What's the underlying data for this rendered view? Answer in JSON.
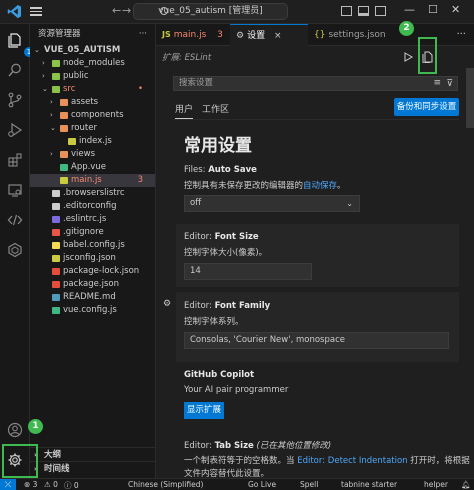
{
  "window": {
    "search_text": "vue_05_autism [管理员]",
    "nav_back": "←",
    "nav_forward": "→"
  },
  "activity": {
    "explorer_badge": "1"
  },
  "sidebar": {
    "header": "资源管理器",
    "more": "···",
    "items": [
      {
        "label": "VUE_05_AUTISM",
        "depth": 0,
        "chev": "⌄",
        "icon": "none",
        "bold": true
      },
      {
        "label": "node_modules",
        "depth": 1,
        "chev": "›",
        "icon": "folder-green"
      },
      {
        "label": "public",
        "depth": 1,
        "chev": "›",
        "icon": "folder-green"
      },
      {
        "label": "src",
        "depth": 1,
        "chev": "⌄",
        "icon": "folder-green",
        "modified": true
      },
      {
        "label": "assets",
        "depth": 2,
        "chev": "›",
        "icon": "folder-orange"
      },
      {
        "label": "components",
        "depth": 2,
        "chev": "›",
        "icon": "folder-orange"
      },
      {
        "label": "router",
        "depth": 2,
        "chev": "⌄",
        "icon": "folder-orange"
      },
      {
        "label": "index.js",
        "depth": 3,
        "chev": "",
        "icon": "js"
      },
      {
        "label": "views",
        "depth": 2,
        "chev": "›",
        "icon": "folder-orange"
      },
      {
        "label": "App.vue",
        "depth": 2,
        "chev": "",
        "icon": "vue"
      },
      {
        "label": "main.js",
        "depth": 2,
        "chev": "",
        "icon": "js",
        "modified": true,
        "badge": "3",
        "selected": true
      },
      {
        "label": ".browserslistrc",
        "depth": 1,
        "chev": "",
        "icon": "gear-dot"
      },
      {
        "label": ".editorconfig",
        "depth": 1,
        "chev": "",
        "icon": "gear-dot"
      },
      {
        "label": ".eslintrc.js",
        "depth": 1,
        "chev": "",
        "icon": "eslint"
      },
      {
        "label": ".gitignore",
        "depth": 1,
        "chev": "",
        "icon": "git"
      },
      {
        "label": "babel.config.js",
        "depth": 1,
        "chev": "",
        "icon": "babel"
      },
      {
        "label": "jsconfig.json",
        "depth": 1,
        "chev": "",
        "icon": "json"
      },
      {
        "label": "package-lock.json",
        "depth": 1,
        "chev": "",
        "icon": "npm"
      },
      {
        "label": "package.json",
        "depth": 1,
        "chev": "",
        "icon": "npm"
      },
      {
        "label": "README.md",
        "depth": 1,
        "chev": "",
        "icon": "md"
      },
      {
        "label": "vue.config.js",
        "depth": 1,
        "chev": "",
        "icon": "vue"
      }
    ],
    "outline_label": "大纲",
    "timeline_label": "时间线"
  },
  "tabs": [
    {
      "icon": "JS",
      "label": "main.js",
      "badge": "3",
      "active": false
    },
    {
      "icon": "gear",
      "label": "设置",
      "active": true,
      "close": "×"
    },
    {
      "icon": "{}",
      "label": "settings.json",
      "active": false
    }
  ],
  "breadcrumb": {
    "text": "扩展: ESLint"
  },
  "settings": {
    "search_placeholder": "搜索设置",
    "tab_user": "用户",
    "tab_workspace": "工作区",
    "sync_button": "备份和同步设置",
    "heading": "常用设置",
    "autosave": {
      "category": "Files: ",
      "name": "Auto Save",
      "desc": "控制具有未保存更改的编辑器的",
      "desc_link": "自动保存",
      "desc_end": "。",
      "value": "off"
    },
    "font_size": {
      "category": "Editor: ",
      "name": "Font Size",
      "desc": "控制字体大小(像素)。",
      "value": "14"
    },
    "font_family": {
      "category": "Editor: ",
      "name": "Font Family",
      "desc": "控制字体系列。",
      "value": "Consolas, 'Courier New', monospace"
    },
    "copilot": {
      "name": "GitHub Copilot",
      "desc": "Your AI pair programmer",
      "button": "显示扩展"
    },
    "tab_size": {
      "category": "Editor: ",
      "name": "Tab Size",
      "note": "(已在其他位置修改)",
      "desc1_pre": "一个制表符等于的空格数。当",
      "desc1_link": "Editor: Detect Indentation",
      "desc1_post": "打开时，将根据",
      "desc2": "文件内容替代此设置。"
    }
  },
  "annotations": [
    {
      "label": "1"
    },
    {
      "label": "2"
    }
  ],
  "statusbar": {
    "errors": "⊗ 3",
    "warnings": "⚠ 0",
    "info": "ⓘ 0",
    "language": "Chinese (Simplified)",
    "golive": "Go Live",
    "spell": "Spell",
    "tabnine": "tabnine starter",
    "helper": "helper"
  }
}
